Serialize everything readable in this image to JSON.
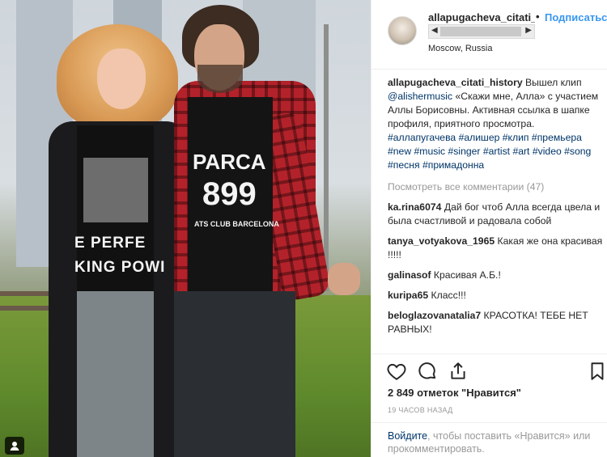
{
  "post": {
    "username": "allapugacheva_citati_h",
    "separator": "•",
    "follow_label": "Подписаться",
    "location": "Moscow, Russia",
    "photo_shirt_text": {
      "woman_line1": "E PERFE",
      "woman_line2": "KING POWI",
      "man_line1": "PARCA",
      "man_line2": "899",
      "man_line3": "ATS CLUB BARCELONA"
    },
    "caption": {
      "author": "allapugacheva_citati_history",
      "text": "Вышел клип",
      "mention": "@alishermusic",
      "text2": "«Скажи мне, Алла» с участием Аллы Борисовны. Активная ссылка в шапке профиля, приятного просмотра.",
      "tags": "#аллапугачева #алишер #клип #премьера #new #music #singer #artist #art #video #song #песня #примадонна"
    },
    "view_all": "Посмотреть все комментарии (47)",
    "comments": [
      {
        "user": "ka.rina6074",
        "text": "Дай бог чтоб Алла всегда цвела и была счастливой и радовала собой"
      },
      {
        "user": "tanya_votyakova_1965",
        "text": "Какая же она красивая !!!!!"
      },
      {
        "user": "galinasof",
        "text": "Красивая А.Б.!"
      },
      {
        "user": "kuripa65",
        "text": "Класс!!!"
      },
      {
        "user": "beloglazovanatalia7",
        "text": "КРАСОТКА! ТЕБЕ НЕТ РАВНЫХ!"
      }
    ],
    "likes": "2 849 отметок \"Нравится\"",
    "timestamp": "19 ЧАСОВ НАЗАД",
    "login_prompt": {
      "link": "Войдите",
      "text": ", чтобы поставить «Нравится» или прокомментировать."
    }
  },
  "icons": {
    "like": "heart-icon",
    "comment": "comment-icon",
    "share": "share-icon",
    "save": "bookmark-icon",
    "tagged": "user-tag-icon"
  },
  "colors": {
    "follow": "#3897f0",
    "link": "#003569",
    "muted": "#999999"
  }
}
